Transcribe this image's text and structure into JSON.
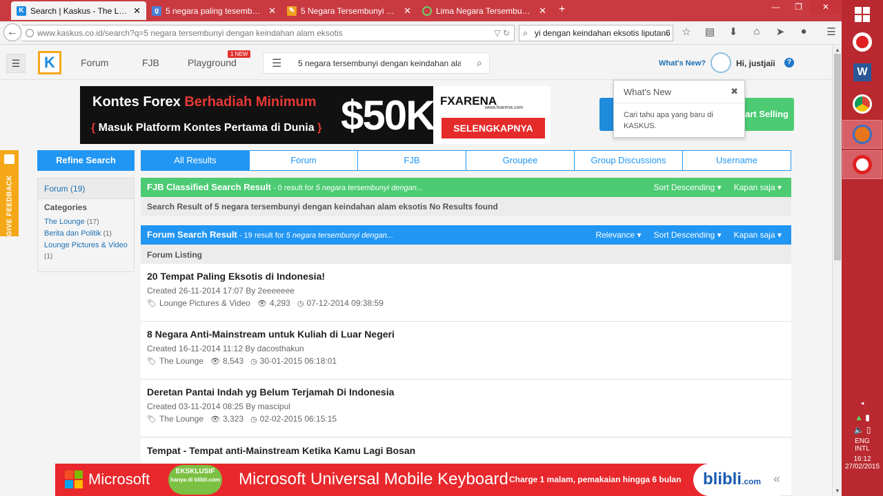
{
  "browser": {
    "tabs": [
      {
        "title": "Search | Kaskus - The Large...",
        "active": true
      },
      {
        "title": "5 negara paling tesembunyi...",
        "active": false
      },
      {
        "title": "5 Negara Tersembunyi den...",
        "active": false
      },
      {
        "title": "Lima Negara Tersembunyi ...",
        "active": false
      }
    ],
    "new_tab_label": "+",
    "url": "www.kaskus.co.id/search?q=5 negara tersembunyi dengan keindahan alam eksotis",
    "search_value": "yi dengan keindahan eksotis liputan6",
    "icons": [
      "star-icon",
      "reading-list-icon",
      "download-icon",
      "home-icon",
      "send-icon",
      "chat-icon",
      "menu-icon"
    ]
  },
  "header": {
    "nav": [
      "Forum",
      "FJB",
      "Playground"
    ],
    "new_badge": "1 NEW",
    "search_query": "5 negara tersembunyi dengan keindahan ala",
    "whats_new_link": "What's New?",
    "greeting": "Hi, justjaii",
    "help": "?"
  },
  "banner": {
    "line1a": "Kontes Forex ",
    "line1b": "Berhadiah Minimum",
    "line2_open": "{ ",
    "line2": "Masuk Platform Kontes Pertama di Dunia",
    "line2_close": " }",
    "amount": "$50K",
    "brand": "FXARENA",
    "brand_url": "www.fxarena.com",
    "cta": "SELENGKAPNYA"
  },
  "start_selling": "art Selling",
  "popover": {
    "title": "What's New",
    "body": "Cari tahu apa yang baru di KASKUS.",
    "close": "✖"
  },
  "feedback_label": "GIVE FEEDBACK",
  "sidebar": {
    "refine": "Refine Search",
    "forum_count": "Forum (19)",
    "categories_title": "Categories",
    "categories": [
      {
        "name": "The Lounge",
        "count": "(17)"
      },
      {
        "name": "Berita dan Politik",
        "count": "(1)"
      },
      {
        "name": "Lounge Pictures & Video",
        "count": "(1)"
      }
    ]
  },
  "filter_tabs": [
    "All Results",
    "Forum",
    "FJB",
    "Groupee",
    "Group Discussions",
    "Username"
  ],
  "fjb": {
    "title": "FJB Classified Search Result",
    "summary_pre": " - 0 result for ",
    "summary_query": "5 negara tersembunyi dengan...",
    "options": [
      "Sort Descending",
      "Kapan saja"
    ],
    "note": "Search Result of 5 negara tersembunyi dengan keindahan alam eksotis No Results found"
  },
  "forum": {
    "title": "Forum Search Result",
    "summary_pre": " - 19 result for ",
    "summary_query": "5 negara tersembunyi dengan...",
    "options": [
      "Relevance",
      "Sort Descending",
      "Kapan saja"
    ],
    "listing_label": "Forum Listing"
  },
  "results": [
    {
      "title": "20 Tempat Paling Eksotis di Indonesia!",
      "created": "Created 26-11-2014 17:07 By 2eeeeeee",
      "category": "Lounge Pictures & Video",
      "views": "4,293",
      "last": "07-12-2014 09:38:59"
    },
    {
      "title": "8 Negara Anti-Mainstream untuk Kuliah di Luar Negeri",
      "created": "Created 16-11-2014 11:12 By dacosthakun",
      "category": "The Lounge",
      "views": "8,543",
      "last": "30-01-2015 06:18:01"
    },
    {
      "title": "Deretan Pantai Indah yg Belum Terjamah Di Indonesia",
      "created": "Created 03-11-2014 08:25 By mascipul",
      "category": "The Lounge",
      "views": "3,323",
      "last": "02-02-2015 06:15:15"
    },
    {
      "title": "Tempat - Tempat anti-Mainstream Ketika Kamu Lagi Bosan",
      "created": "",
      "category": "",
      "views": "",
      "last": ""
    }
  ],
  "ad": {
    "brand": "Microsoft",
    "exclusive": "EKSKLUSIF",
    "exclusive_sub": "hanya di blibli.com",
    "product": "Microsoft Universal Mobile Keyboard",
    "charge": "Charge 1 malam, pemakaian hingga 6 bulan",
    "store": "blibli",
    "store_tld": ".com"
  },
  "tray": {
    "lang1": "ENG",
    "lang2": "INTL",
    "time": "16:12",
    "date": "27/02/2015"
  },
  "colors": {
    "tabbar": "#c93a40",
    "kaskus_blue": "#2196f3",
    "fjb_green": "#4ccb73",
    "taskbar": "#b9292f"
  }
}
